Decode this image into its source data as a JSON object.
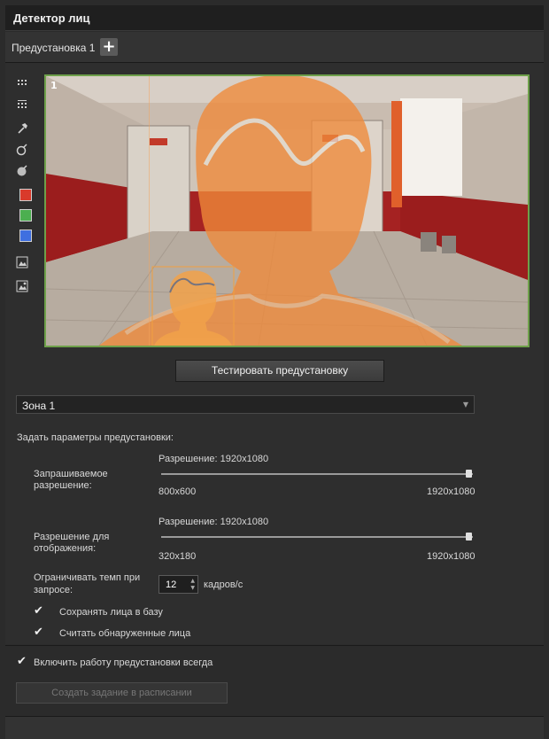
{
  "header": {
    "title": "Детектор лиц"
  },
  "preset_bar": {
    "label": "Предустановка 1",
    "add_glyph": "+"
  },
  "video": {
    "channel_number": "1"
  },
  "toolbar": {
    "icons": [
      "grid-small-icon",
      "grid-dots-icon",
      "pipette-icon",
      "pipette-minus-icon",
      "pipette-plus-icon",
      "red-square-icon",
      "green-square-icon",
      "blue-square-icon",
      "image-icon",
      "image-add-icon"
    ],
    "colors": {
      "red": "#d93a2b",
      "green": "#4caf50",
      "blue": "#3f6fe0"
    }
  },
  "test_button": {
    "label": "Тестировать предустановку"
  },
  "zone_select": {
    "value": "Зона 1"
  },
  "params": {
    "heading": "Задать параметры предустановки:",
    "requested": {
      "label_line1": "Запрашиваемое",
      "label_line2": "разрешение:",
      "resolution_text": "Разрешение: 1920x1080",
      "min": "800x600",
      "max": "1920x1080",
      "level": 1.0
    },
    "display": {
      "label_line1": "Разрешение для",
      "label_line2": "отображения:",
      "resolution_text": "Разрешение: 1920x1080",
      "min": "320x180",
      "max": "1920x1080",
      "level": 1.0
    },
    "fps": {
      "label_line1": "Ограничивать темп при",
      "label_line2": "запросе:",
      "value": "12",
      "unit": "кадров/с"
    },
    "save_faces": {
      "label": "Сохранять лица в базу",
      "checked": true
    },
    "count_faces": {
      "label": "Считать обнаруженные лица",
      "checked": true
    }
  },
  "always_enable": {
    "label": "Включить работу предустановки всегда",
    "checked": true
  },
  "schedule_button": {
    "label": "Создать задание в расписании"
  },
  "accent_colors": {
    "video_border": "#6ea04a",
    "face_overlay": "#f08a3a"
  }
}
